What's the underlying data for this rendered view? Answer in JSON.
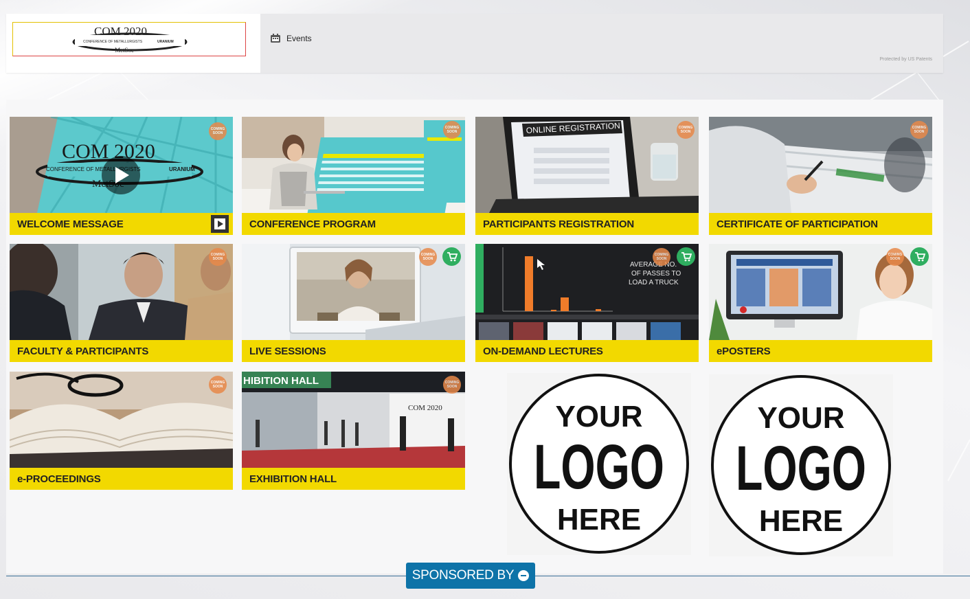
{
  "header": {
    "logo": {
      "title": "COM 2020",
      "subtitle_left": "CONFERENCE OF METALLURGISTS",
      "subtitle_right": "URANIUM",
      "org": "MetSoc"
    },
    "nav": {
      "events_label": "Events"
    },
    "patent_note": "Protected by US Patents"
  },
  "tiles": [
    {
      "label": "WELCOME MESSAGE",
      "image_text": "COM 2020",
      "image_sub": "CONFERENCE OF METALLURGISTS",
      "image_sub2": "URANIUM",
      "image_org": "MetSoc",
      "badge": "COMING SOON"
    },
    {
      "label": "CONFERENCE PROGRAM",
      "badge": "COMING SOON"
    },
    {
      "label": "PARTICIPANTS REGISTRATION",
      "image_text": "ONLINE REGISTRATION",
      "badge": "COMING SOON"
    },
    {
      "label": "CERTIFICATE OF PARTICIPATION",
      "badge": "COMING SOON"
    },
    {
      "label": "FACULTY & PARTICIPANTS",
      "badge": "COMING SOON"
    },
    {
      "label": "LIVE SESSIONS",
      "badge": "COMING SOON"
    },
    {
      "label": "ON-DEMAND LECTURES",
      "image_text": "AVERAGE NO. OF PASSES TO LOAD A TRUCK",
      "badge": "COMING SOON"
    },
    {
      "label": "ePOSTERS",
      "badge": "COMING SOON"
    },
    {
      "label": "e-PROCEEDINGS",
      "badge": "COMING SOON"
    },
    {
      "label": "EXHIBITION HALL",
      "image_text": "HIBITION HALL",
      "image_sub": "COM 2020",
      "badge": "COMING SOON"
    }
  ],
  "sponsor_logos": [
    {
      "top": "YOUR",
      "mid": "LOGO",
      "bottom": "HERE"
    },
    {
      "top": "YOUR",
      "mid": "LOGO",
      "bottom": "HERE"
    }
  ],
  "footer": {
    "sponsored_label": "SPONSORED BY"
  },
  "colors": {
    "caption_yellow": "#f2d900",
    "sponsor_blue": "#0e73a8",
    "cart_green": "#2fae60",
    "badge_orange": "#e8894a"
  }
}
